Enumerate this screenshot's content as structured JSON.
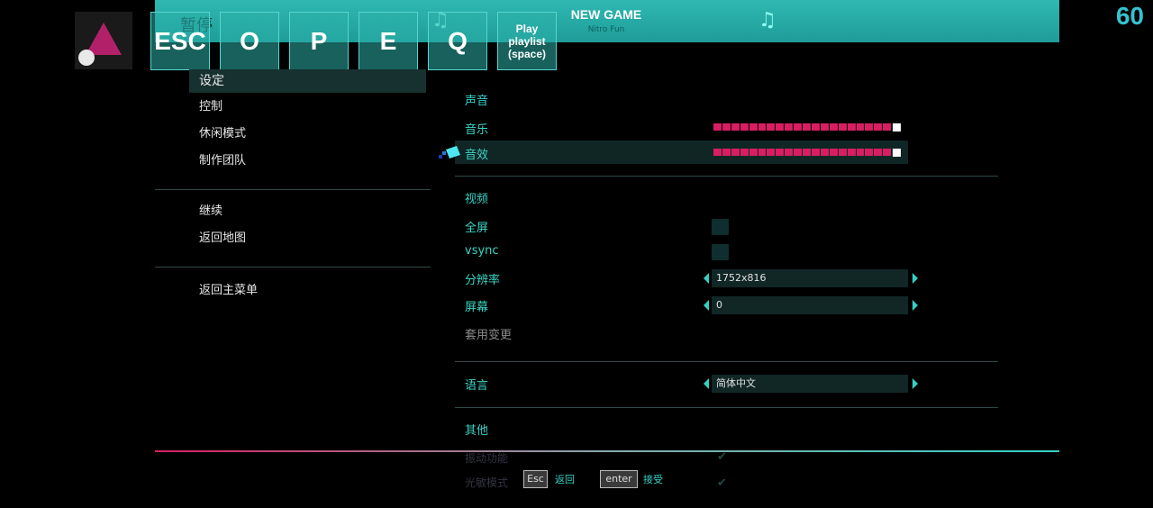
{
  "topbar": {
    "pause_label": "暂停",
    "song_title": "NEW GAME",
    "song_artist": "Nitro Fun",
    "note_icon": "music-note-icon",
    "fps": "60"
  },
  "keys": [
    "ESC",
    "O",
    "P",
    "E",
    "Q"
  ],
  "playlist_key": {
    "line1": "Play",
    "line2": "playlist",
    "line3": "(space)"
  },
  "menu": {
    "items": [
      "设定",
      "控制",
      "休闲模式",
      "制作团队"
    ],
    "group2": [
      "继续",
      "返回地图"
    ],
    "group3": [
      "返回主菜单"
    ]
  },
  "settings": {
    "sound": {
      "title": "声音",
      "music_label": "音乐",
      "sfx_label": "音效",
      "music_level": 1.0,
      "sfx_level": 1.0
    },
    "video": {
      "title": "视频",
      "fullscreen_label": "全屏",
      "vsync_label": "vsync",
      "resolution_label": "分辨率",
      "resolution_value": "1752x816",
      "screen_label": "屏幕",
      "screen_value": "0",
      "apply_label": "套用变更"
    },
    "language": {
      "label": "语言",
      "value": "简体中文"
    },
    "other": {
      "title": "其他",
      "row1": "振动功能",
      "row2": "光敏模式"
    }
  },
  "footer": {
    "esc_key": "Esc",
    "esc_label": "返回",
    "enter_key": "enter",
    "enter_label": "接受"
  },
  "colors": {
    "accent": "#35d0c4",
    "slider": "#d81e62",
    "topbar": "#2fb8b2"
  }
}
